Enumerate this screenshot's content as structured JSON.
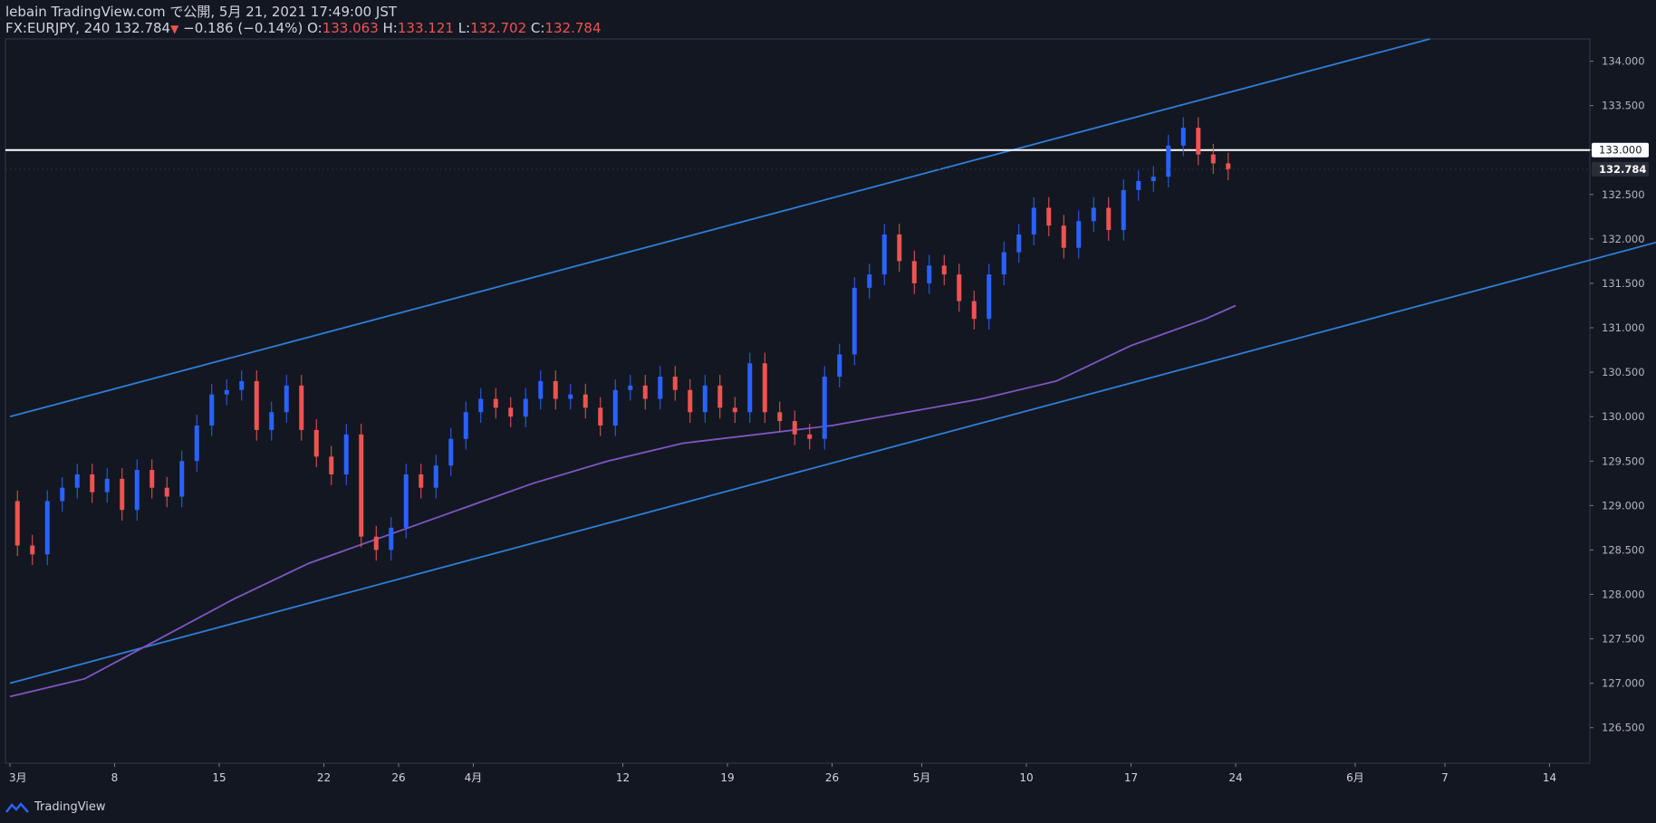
{
  "header": {
    "line1": "lebain TradingView.com で公開, 5月 21, 2021 17:49:00 JST",
    "symbol_prefix": "FX:EURJPY, 240 132.784",
    "arrow": "▼",
    "change": "−0.186 (−0.14%)",
    "o_label": "O:",
    "o_value": "133.063",
    "h_label": "H:",
    "h_value": "133.121",
    "l_label": "L:",
    "l_value": "132.702",
    "c_label": "C:",
    "c_value": "132.784"
  },
  "footer": {
    "brand": "TradingView"
  },
  "colors": {
    "background": "#131722",
    "up": "#2962ff",
    "down": "#ef5350",
    "channel": "#2f7ed8",
    "ma": "#7e57c2",
    "level": "#ffffff"
  },
  "chart_data": {
    "type": "line",
    "symbol": "FX:EURJPY",
    "interval": "240",
    "ylim": [
      126.1,
      134.25
    ],
    "yticks": [
      "126.500",
      "127.000",
      "127.500",
      "128.000",
      "128.500",
      "129.000",
      "129.500",
      "130.000",
      "130.500",
      "131.000",
      "131.500",
      "132.000",
      "132.500",
      "133.000",
      "133.500",
      "134.000"
    ],
    "xticks": [
      {
        "label": "3月",
        "day": 0
      },
      {
        "label": "8",
        "day": 7
      },
      {
        "label": "15",
        "day": 14
      },
      {
        "label": "22",
        "day": 21
      },
      {
        "label": "26",
        "day": 26
      },
      {
        "label": "4月",
        "day": 31
      },
      {
        "label": "12",
        "day": 41
      },
      {
        "label": "19",
        "day": 48
      },
      {
        "label": "26",
        "day": 55
      },
      {
        "label": "5月",
        "day": 61
      },
      {
        "label": "10",
        "day": 68
      },
      {
        "label": "17",
        "day": 75
      },
      {
        "label": "24",
        "day": 82
      },
      {
        "label": "6月",
        "day": 90
      },
      {
        "label": "7",
        "day": 96
      },
      {
        "label": "14",
        "day": 103
      }
    ],
    "price_label": "132.784",
    "horizontal_level": {
      "value": 133.0,
      "label": "133.000"
    },
    "closes": [
      {
        "day": 0,
        "close": 129.05
      },
      {
        "day": 1,
        "close": 128.55
      },
      {
        "day": 2,
        "close": 128.45
      },
      {
        "day": 3,
        "close": 129.05
      },
      {
        "day": 4,
        "close": 129.2
      },
      {
        "day": 5,
        "close": 129.35
      },
      {
        "day": 6,
        "close": 129.15
      },
      {
        "day": 7,
        "close": 129.3
      },
      {
        "day": 8,
        "close": 128.95
      },
      {
        "day": 9,
        "close": 129.4
      },
      {
        "day": 10,
        "close": 129.2
      },
      {
        "day": 11,
        "close": 129.1
      },
      {
        "day": 12,
        "close": 129.5
      },
      {
        "day": 13,
        "close": 129.9
      },
      {
        "day": 14,
        "close": 130.25
      },
      {
        "day": 15,
        "close": 130.3
      },
      {
        "day": 16,
        "close": 130.4
      },
      {
        "day": 17,
        "close": 129.85
      },
      {
        "day": 18,
        "close": 130.05
      },
      {
        "day": 19,
        "close": 130.35
      },
      {
        "day": 20,
        "close": 129.85
      },
      {
        "day": 21,
        "close": 129.55
      },
      {
        "day": 22,
        "close": 129.35
      },
      {
        "day": 23,
        "close": 129.8
      },
      {
        "day": 24,
        "close": 128.65
      },
      {
        "day": 25,
        "close": 128.5
      },
      {
        "day": 26,
        "close": 128.75
      },
      {
        "day": 27,
        "close": 129.35
      },
      {
        "day": 28,
        "close": 129.2
      },
      {
        "day": 29,
        "close": 129.45
      },
      {
        "day": 30,
        "close": 129.75
      },
      {
        "day": 31,
        "close": 130.05
      },
      {
        "day": 32,
        "close": 130.2
      },
      {
        "day": 33,
        "close": 130.1
      },
      {
        "day": 34,
        "close": 130.0
      },
      {
        "day": 35,
        "close": 130.2
      },
      {
        "day": 36,
        "close": 130.4
      },
      {
        "day": 37,
        "close": 130.2
      },
      {
        "day": 38,
        "close": 130.25
      },
      {
        "day": 39,
        "close": 130.1
      },
      {
        "day": 40,
        "close": 129.9
      },
      {
        "day": 41,
        "close": 130.3
      },
      {
        "day": 42,
        "close": 130.35
      },
      {
        "day": 43,
        "close": 130.2
      },
      {
        "day": 44,
        "close": 130.45
      },
      {
        "day": 45,
        "close": 130.3
      },
      {
        "day": 46,
        "close": 130.05
      },
      {
        "day": 47,
        "close": 130.35
      },
      {
        "day": 48,
        "close": 130.1
      },
      {
        "day": 49,
        "close": 130.05
      },
      {
        "day": 50,
        "close": 130.6
      },
      {
        "day": 51,
        "close": 130.05
      },
      {
        "day": 52,
        "close": 129.95
      },
      {
        "day": 53,
        "close": 129.8
      },
      {
        "day": 54,
        "close": 129.75
      },
      {
        "day": 55,
        "close": 130.45
      },
      {
        "day": 56,
        "close": 130.7
      },
      {
        "day": 57,
        "close": 131.45
      },
      {
        "day": 58,
        "close": 131.6
      },
      {
        "day": 59,
        "close": 132.05
      },
      {
        "day": 60,
        "close": 131.75
      },
      {
        "day": 61,
        "close": 131.5
      },
      {
        "day": 62,
        "close": 131.7
      },
      {
        "day": 63,
        "close": 131.6
      },
      {
        "day": 64,
        "close": 131.3
      },
      {
        "day": 65,
        "close": 131.1
      },
      {
        "day": 66,
        "close": 131.6
      },
      {
        "day": 67,
        "close": 131.85
      },
      {
        "day": 68,
        "close": 132.05
      },
      {
        "day": 69,
        "close": 132.35
      },
      {
        "day": 70,
        "close": 132.15
      },
      {
        "day": 71,
        "close": 131.9
      },
      {
        "day": 72,
        "close": 132.2
      },
      {
        "day": 73,
        "close": 132.35
      },
      {
        "day": 74,
        "close": 132.1
      },
      {
        "day": 75,
        "close": 132.55
      },
      {
        "day": 76,
        "close": 132.65
      },
      {
        "day": 77,
        "close": 132.7
      },
      {
        "day": 78,
        "close": 133.05
      },
      {
        "day": 79,
        "close": 133.25
      },
      {
        "day": 80,
        "close": 132.95
      },
      {
        "day": 81,
        "close": 132.85
      },
      {
        "day": 82,
        "close": 132.78
      }
    ],
    "moving_average": [
      {
        "day": 0,
        "value": 126.85
      },
      {
        "day": 5,
        "value": 127.05
      },
      {
        "day": 10,
        "value": 127.5
      },
      {
        "day": 15,
        "value": 127.95
      },
      {
        "day": 20,
        "value": 128.35
      },
      {
        "day": 25,
        "value": 128.65
      },
      {
        "day": 30,
        "value": 128.95
      },
      {
        "day": 35,
        "value": 129.25
      },
      {
        "day": 40,
        "value": 129.5
      },
      {
        "day": 45,
        "value": 129.7
      },
      {
        "day": 50,
        "value": 129.8
      },
      {
        "day": 55,
        "value": 129.9
      },
      {
        "day": 60,
        "value": 130.05
      },
      {
        "day": 65,
        "value": 130.2
      },
      {
        "day": 70,
        "value": 130.4
      },
      {
        "day": 75,
        "value": 130.8
      },
      {
        "day": 80,
        "value": 131.1
      },
      {
        "day": 82,
        "value": 131.25
      }
    ],
    "channel_lines": [
      {
        "name": "upper",
        "points": [
          {
            "day": 0,
            "value": 130.0
          },
          {
            "day": 95,
            "value": 134.25
          }
        ]
      },
      {
        "name": "lower",
        "points": [
          {
            "day": 0,
            "value": 127.0
          },
          {
            "day": 111,
            "value": 132.0
          }
        ]
      }
    ]
  }
}
